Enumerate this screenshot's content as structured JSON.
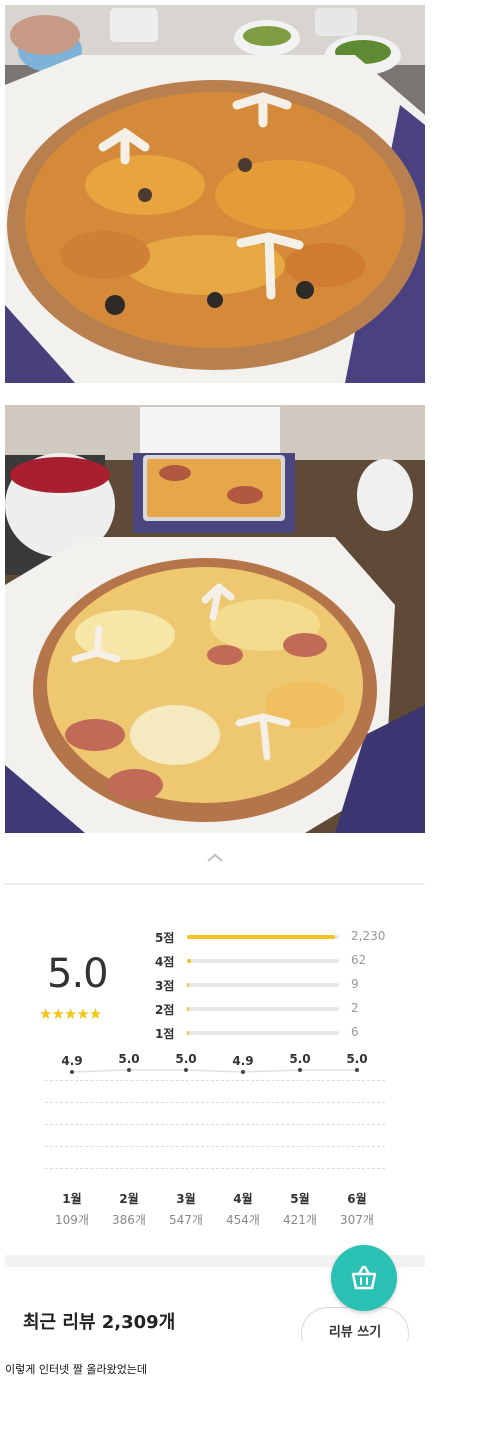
{
  "photos": [
    {
      "name": "pizza-photo-1",
      "subject": "pizza"
    },
    {
      "name": "pizza-photo-2",
      "subject": "pizza with side dish"
    }
  ],
  "reviews": {
    "collapse_icon": "chevron-up-icon",
    "average": "5.0",
    "stars": "★★★★★",
    "star_color": "#f5c516",
    "bar_color": "#f2c322",
    "accent_color": "#2bc0b4",
    "distribution": [
      {
        "label": "5점",
        "count": "2,230",
        "fraction": 0.973
      },
      {
        "label": "4점",
        "count": "62",
        "fraction": 0.027
      },
      {
        "label": "3점",
        "count": "9",
        "fraction": 0.004
      },
      {
        "label": "2점",
        "count": "2",
        "fraction": 0.001
      },
      {
        "label": "1점",
        "count": "6",
        "fraction": 0.003
      }
    ],
    "monthly": [
      {
        "month": "1월",
        "count": "109개",
        "score": "4.9"
      },
      {
        "month": "2월",
        "count": "386개",
        "score": "5.0"
      },
      {
        "month": "3월",
        "count": "547개",
        "score": "5.0"
      },
      {
        "month": "4월",
        "count": "454개",
        "score": "4.9"
      },
      {
        "month": "5월",
        "count": "421개",
        "score": "5.0"
      },
      {
        "month": "6월",
        "count": "307개",
        "score": "5.0"
      }
    ],
    "recent_title": "최근 리뷰 2,309개",
    "write_button": "리뷰 쓰기",
    "cart_icon": "basket-icon"
  },
  "caption": "이렇게 인터넷 짤 올라왔었는데"
}
